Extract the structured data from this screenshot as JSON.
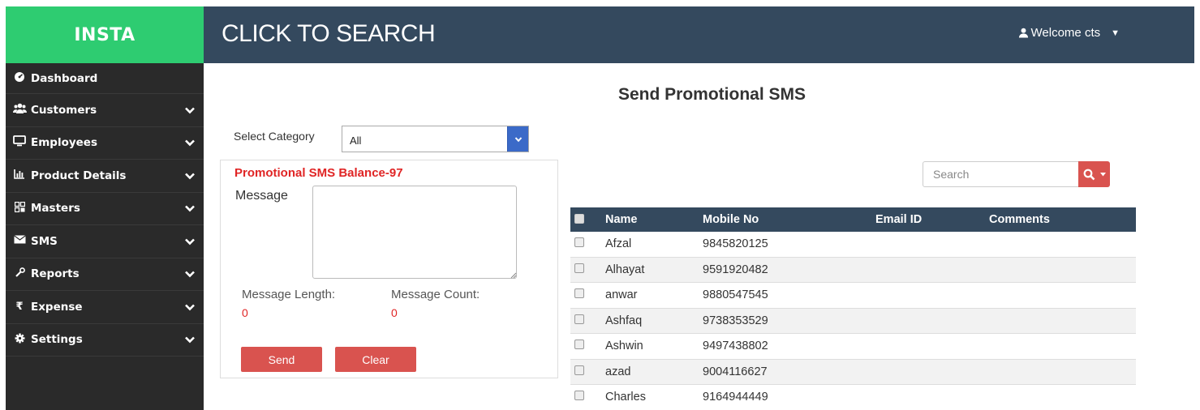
{
  "app": {
    "brand": "INSTA",
    "search_link": "CLICK TO SEARCH",
    "welcome": "Welcome cts"
  },
  "sidebar": {
    "items": [
      {
        "label": "Dashboard",
        "icon": "dashboard-icon",
        "expandable": false
      },
      {
        "label": "Customers",
        "icon": "users-icon",
        "expandable": true
      },
      {
        "label": "Employees",
        "icon": "desktop-icon",
        "expandable": true
      },
      {
        "label": "Product Details",
        "icon": "bar-chart-icon",
        "expandable": true
      },
      {
        "label": "Masters",
        "icon": "grid-icon",
        "expandable": true
      },
      {
        "label": "SMS",
        "icon": "envelope-icon",
        "expandable": true
      },
      {
        "label": "Reports",
        "icon": "wrench-icon",
        "expandable": true
      },
      {
        "label": "Expense",
        "icon": "rupee-icon",
        "expandable": true
      },
      {
        "label": "Settings",
        "icon": "gear-icon",
        "expandable": true
      }
    ]
  },
  "main": {
    "title": "Send Promotional SMS",
    "category_label": "Select Category",
    "category_value": "All",
    "balance": "Promotional SMS Balance-97",
    "message_label": "Message",
    "message_value": "",
    "length_label": "Message Length:",
    "length_value": "0",
    "count_label": "Message Count:",
    "count_value": "0",
    "send_label": "Send",
    "clear_label": "Clear"
  },
  "search": {
    "placeholder": "Search"
  },
  "table": {
    "headers": [
      "Name",
      "Mobile No",
      "Email ID",
      "Comments"
    ],
    "rows": [
      {
        "name": "Afzal",
        "mobile": "9845820125"
      },
      {
        "name": "Alhayat",
        "mobile": "9591920482"
      },
      {
        "name": "anwar",
        "mobile": "9880547545"
      },
      {
        "name": "Ashfaq",
        "mobile": "9738353529"
      },
      {
        "name": "Ashwin",
        "mobile": "9497438802"
      },
      {
        "name": "azad",
        "mobile": "9004116627"
      },
      {
        "name": "Charles",
        "mobile": "9164944449"
      }
    ]
  },
  "colors": {
    "brand": "#2ecc71",
    "topbar": "#34495e",
    "sidebar": "#2a2a2a",
    "danger": "#d9534f",
    "select_button": "#3b6ac8"
  }
}
